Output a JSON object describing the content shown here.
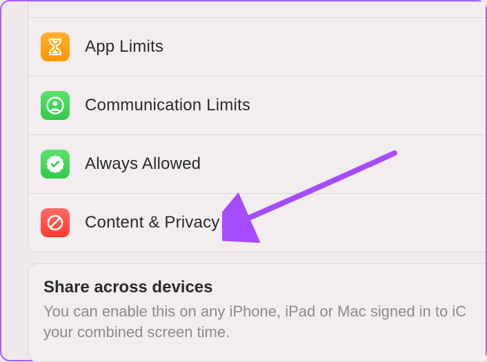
{
  "rows": {
    "app_limits": {
      "label": "App Limits"
    },
    "communication_limits": {
      "label": "Communication Limits"
    },
    "always_allowed": {
      "label": "Always Allowed"
    },
    "content_privacy": {
      "label": "Content & Privacy"
    }
  },
  "section": {
    "title": "Share across devices",
    "desc": "You can enable this on any iPhone, iPad or Mac signed in to iC your combined screen time."
  },
  "annotation": {
    "arrow_color": "#a54cff"
  }
}
